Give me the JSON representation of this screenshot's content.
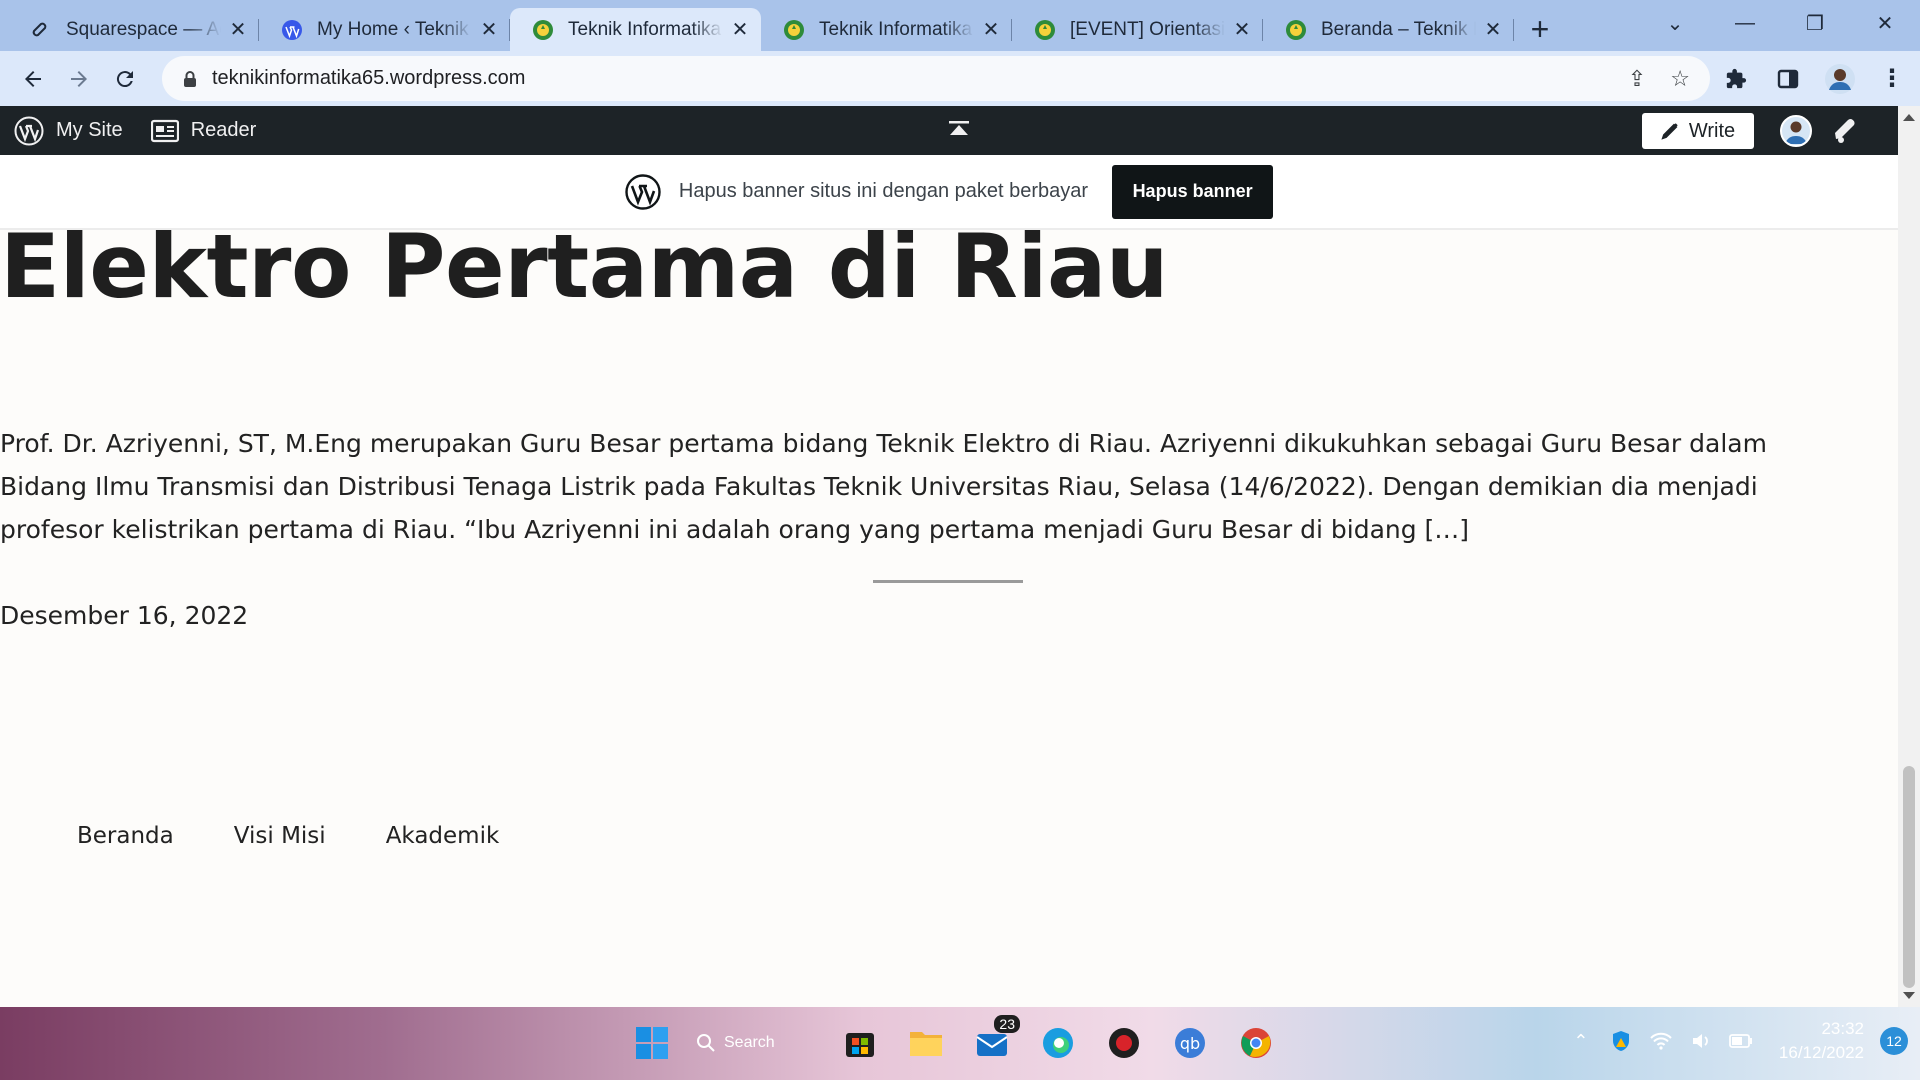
{
  "browser": {
    "tabs": [
      {
        "title": "Squarespace — Account Dashboard",
        "icon": "squarespace-icon",
        "active": false
      },
      {
        "title": "My Home ‹ Teknik Informatika",
        "icon": "wordpress-icon",
        "active": false
      },
      {
        "title": "Teknik Informatika Universitas",
        "icon": "site-logo-icon",
        "active": true
      },
      {
        "title": "Teknik Informatika Universitas",
        "icon": "site-logo-icon",
        "active": false
      },
      {
        "title": "[EVENT] Orientasi Program",
        "icon": "site-logo-icon",
        "active": false
      },
      {
        "title": "Beranda – Teknik Informatika",
        "icon": "site-logo-icon",
        "active": false
      }
    ],
    "new_tab_label": "+",
    "close_label": "✕",
    "url": "teknikinformatika65.wordpress.com"
  },
  "wp_admin_bar": {
    "my_site": "My Site",
    "reader": "Reader",
    "write": "Write"
  },
  "banner": {
    "message": "Hapus banner situs ini dengan paket berbayar",
    "button": "Hapus banner"
  },
  "post": {
    "title": "Elektro Pertama di Riau",
    "excerpt": "Prof. Dr. Azriyenni, ST, M.Eng merupakan Guru Besar pertama bidang Teknik Elektro di Riau. Azriyenni dikukuhkan sebagai Guru Besar dalam Bidang Ilmu Transmisi dan Distribusi Tenaga Listrik pada Fakultas Teknik Universitas Riau, Selasa (14/6/2022). Dengan demikian dia menjadi profesor kelistrikan pertama di Riau. “Ibu Azriyenni ini adalah orang yang pertama menjadi Guru Besar di bidang […]",
    "date": "Desember 16, 2022"
  },
  "footer_nav": [
    "Beranda",
    "Visi Misi",
    "Akademik"
  ],
  "taskbar": {
    "search_label": "Search",
    "mail_badge": "23",
    "time": "23:32",
    "date": "16/12/2022",
    "notification_count": "12"
  },
  "colors": {
    "tab_strip": "#a9c3ea",
    "toolbar": "#dce8fa",
    "wp_bar": "#1d2327",
    "page_bg": "#fdfcfa",
    "banner_button": "#101517"
  }
}
